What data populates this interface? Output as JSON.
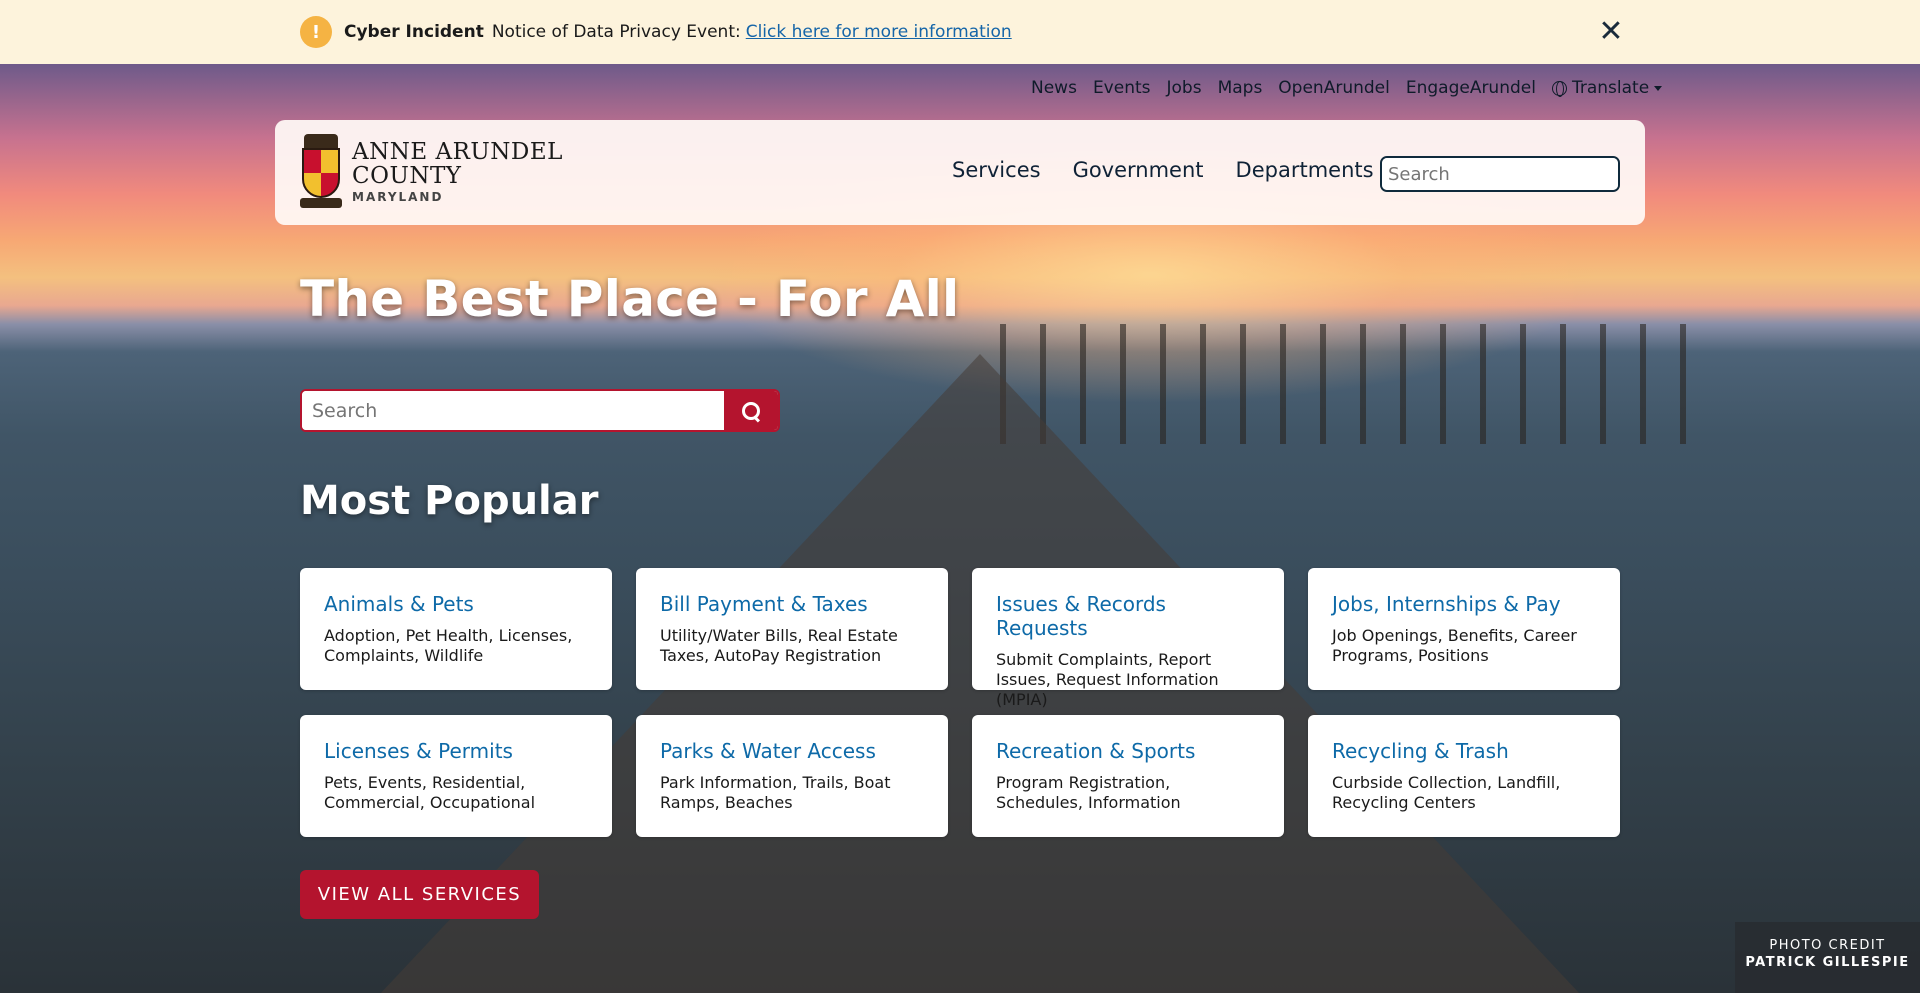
{
  "alert": {
    "icon": "exclamation-icon",
    "title": "Cyber Incident",
    "text": "Notice of Data Privacy Event:",
    "link": "Click here for more information",
    "close": "✕"
  },
  "util_nav": {
    "items": [
      "News",
      "Events",
      "Jobs",
      "Maps",
      "OpenArundel",
      "EngageArundel"
    ],
    "translate": "Translate"
  },
  "logo": {
    "line1": "ANNE ARUNDEL",
    "line2": "COUNTY",
    "line3": "MARYLAND"
  },
  "main_nav": {
    "items": [
      "Services",
      "Government",
      "Departments"
    ]
  },
  "header_search": {
    "placeholder": "Search"
  },
  "hero": {
    "title": "The Best Place - For All",
    "search_placeholder": "Search",
    "popular_title": "Most Popular"
  },
  "cards": [
    {
      "title": "Animals & Pets",
      "desc": "Adoption, Pet Health, Licenses, Complaints, Wildlife"
    },
    {
      "title": "Bill Payment & Taxes",
      "desc": "Utility/Water Bills, Real Estate Taxes, AutoPay Registration"
    },
    {
      "title": "Issues & Records Requests",
      "desc": "Submit Complaints, Report Issues, Request Information (MPIA)"
    },
    {
      "title": "Jobs, Internships & Pay",
      "desc": "Job Openings, Benefits, Career Programs, Positions"
    },
    {
      "title": "Licenses & Permits",
      "desc": "Pets, Events, Residential, Commercial, Occupational"
    },
    {
      "title": "Parks & Water Access",
      "desc": "Park Information, Trails, Boat Ramps, Beaches"
    },
    {
      "title": "Recreation & Sports",
      "desc": "Program Registration, Schedules, Information"
    },
    {
      "title": "Recycling & Trash",
      "desc": "Curbside Collection, Landfill, Recycling Centers"
    }
  ],
  "view_all": "VIEW ALL SERVICES",
  "credit": {
    "line1": "PHOTO CREDIT",
    "line2": "PATRICK GILLESPIE"
  },
  "colors": {
    "accent_red": "#b4142e",
    "navy": "#0f2a3c",
    "link_blue": "#0e6aa8",
    "alert_bg": "#fdf3dc",
    "alert_icon": "#f5b343"
  }
}
